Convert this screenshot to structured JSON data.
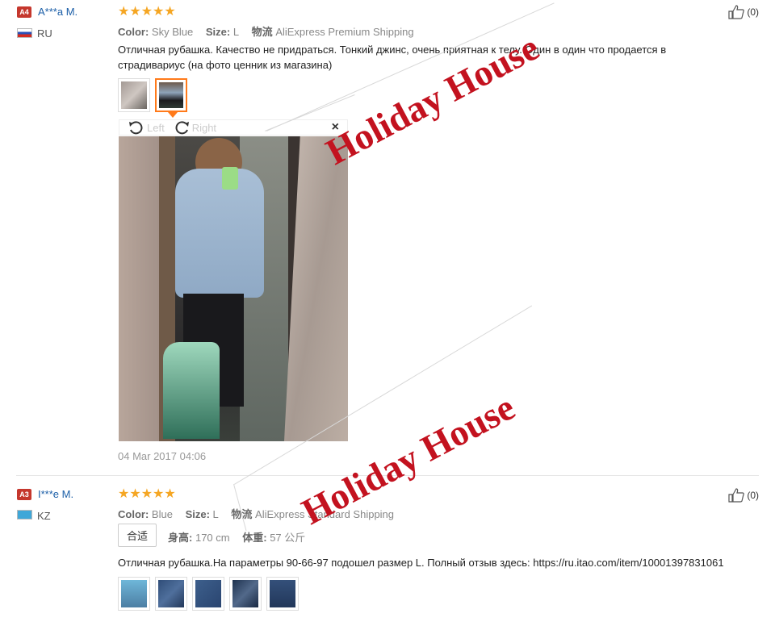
{
  "reviews": [
    {
      "badge": "A4",
      "user": "A***a M.",
      "country": "RU",
      "stars": "★★★★★",
      "color_label": "Color:",
      "color_value": "Sky Blue",
      "size_label": "Size:",
      "size_value": "L",
      "ship_label": "物流",
      "ship_value": "AliExpress Premium Shipping",
      "text_line1": "Отличная рубашка. Качество не придраться. Тонкий джинс, очень приятная к телу. Один в один что продается в",
      "text_line2": "страдивариус (на фото ценник из магазина)",
      "like": "(0)",
      "viewer_left": "Left",
      "viewer_right": "Right",
      "viewer_close": "×",
      "date": "04 Mar 2017 04:06"
    },
    {
      "badge": "A3",
      "user": "I***e M.",
      "country": "KZ",
      "stars": "★★★★★",
      "color_label": "Color:",
      "color_value": "Blue",
      "size_label": "Size:",
      "size_value": "L",
      "ship_label": "物流",
      "ship_value": "AliExpress Standard Shipping",
      "fit_tag": "合适",
      "height_label": "身高:",
      "height_value": "170 cm",
      "weight_label": "体重:",
      "weight_value": "57 公斤",
      "text": "Отличная рубашка.На параметры 90-66-97 подошел размер L. Полный отзыв здесь: https://ru.itao.com/item/10001397831061",
      "like": "(0)"
    }
  ],
  "watermark": "Holiday House",
  "colors": {
    "accent": "#ff7a1a",
    "star": "#f5a623",
    "link": "#1c5fa8",
    "badge": "#c5372d",
    "watermark": "#c3121f"
  }
}
